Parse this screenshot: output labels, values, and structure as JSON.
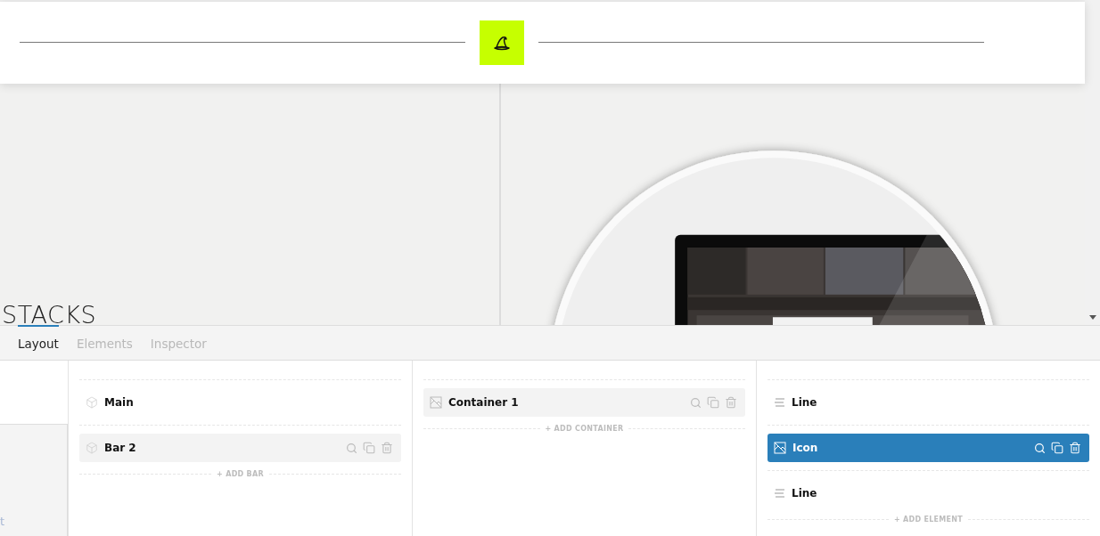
{
  "canvas": {
    "heading": "STACKS"
  },
  "tabs": [
    {
      "label": "Layout",
      "selected": true
    },
    {
      "label": "Elements",
      "selected": false
    },
    {
      "label": "Inspector",
      "selected": false
    }
  ],
  "side_pane": {
    "text": "t"
  },
  "columns": [
    {
      "items": [
        {
          "kind": "cube",
          "label": "Main",
          "highlighted": false,
          "selected": false
        },
        {
          "kind": "cube",
          "label": "Bar 2",
          "highlighted": true,
          "selected": false
        }
      ],
      "add_label": "+ ADD BAR"
    },
    {
      "items": [
        {
          "kind": "picture",
          "label": "Container 1",
          "highlighted": true,
          "selected": false
        }
      ],
      "add_label": "+ ADD CONTAINER"
    },
    {
      "items": [
        {
          "kind": "lines",
          "label": "Line",
          "highlighted": false,
          "selected": false
        },
        {
          "kind": "picture",
          "label": "Icon",
          "highlighted": true,
          "selected": true
        },
        {
          "kind": "lines",
          "label": "Line",
          "highlighted": false,
          "selected": false
        }
      ],
      "add_label": "+ ADD ELEMENT"
    }
  ]
}
